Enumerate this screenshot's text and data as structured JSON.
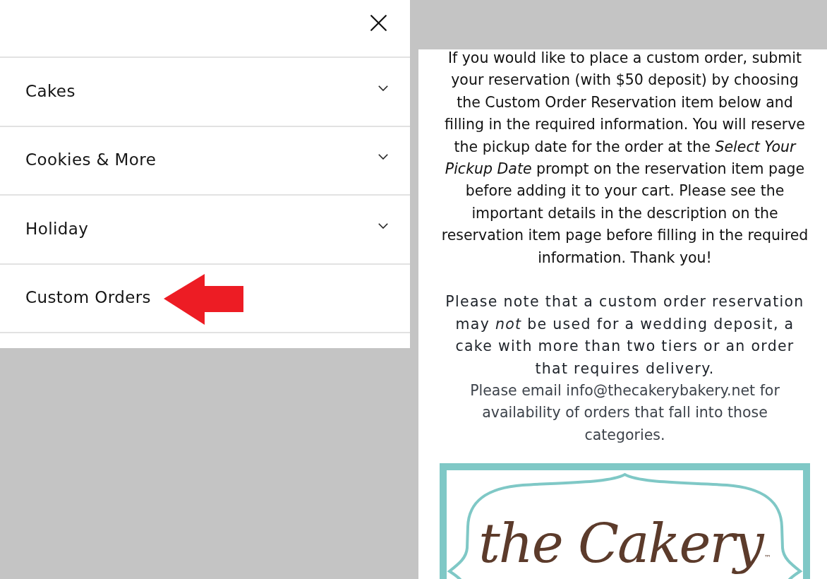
{
  "drawer": {
    "items": [
      {
        "label": "Cakes",
        "kind": "dropdown",
        "pointed_at": false
      },
      {
        "label": "Cookies & More",
        "kind": "dropdown",
        "pointed_at": false
      },
      {
        "label": "Holiday",
        "kind": "dropdown",
        "pointed_at": false
      },
      {
        "label": "Custom Orders",
        "kind": "link",
        "pointed_at": true
      }
    ]
  },
  "content": {
    "paragraphs": [
      {
        "kind": "body",
        "text": "If you would like to place a custom order, submit your reservation (with $50 deposit) by choosing the Custom Order Reservation item below and filling in the required information. You will reserve the pickup date for the order at the *Select Your Pickup Date* prompt on the reservation item page before adding it to your cart. Please see the important details in the description on the reservation item page before filling in the required information. Thank you!"
      },
      {
        "kind": "notice",
        "text": "Please note that a custom order reservation may *not* be used for a wedding deposit, a cake with more than two tiers or an order that requires delivery."
      },
      {
        "kind": "note",
        "text": "Please email info@thecakerybakery.net for availability of orders that fall into those categories."
      }
    ]
  },
  "logo": {
    "text": "the Cakery",
    "trademark": "™"
  }
}
